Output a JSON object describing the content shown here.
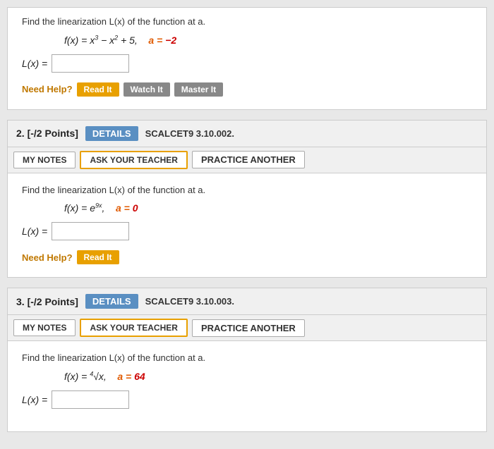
{
  "cards": [
    {
      "id": "card1",
      "number": "2. [-/2 Points]",
      "details_label": "DETAILS",
      "code": "SCALCET9 3.10.002.",
      "my_notes_label": "MY NOTES",
      "ask_teacher_label": "ASK YOUR TEACHER",
      "practice_label": "PRACTICE ANOTHER",
      "instruction": "Find the linearization L(x) of the function at a.",
      "formula_parts": {
        "fx": "f(x) = e",
        "exp": "9x",
        "comma": ",",
        "a_label": "a",
        "a_eq": "=",
        "a_val": "0"
      },
      "lx_label": "L(x) =",
      "need_help_label": "Need Help?",
      "help_buttons": [
        "Read It"
      ]
    },
    {
      "id": "card2",
      "number": "3. [-/2 Points]",
      "details_label": "DETAILS",
      "code": "SCALCET9 3.10.003.",
      "my_notes_label": "MY NOTES",
      "ask_teacher_label": "ASK YOUR TEACHER",
      "practice_label": "PRACTICE ANOTHER",
      "instruction": "Find the linearization L(x) of the function at a.",
      "formula_parts": {
        "fx": "f(x) = ",
        "root": "4",
        "under": "x",
        "comma": ",",
        "a_label": "a",
        "a_eq": "=",
        "a_val": "64"
      },
      "lx_label": "L(x) =",
      "need_help_label": null,
      "help_buttons": []
    }
  ],
  "top_snippet": {
    "instruction": "Find the linearization L(x) of the function at a.",
    "formula": "f(x) = x³ − x² + 5,",
    "a_label": "a",
    "a_eq": "=",
    "a_val": "−2",
    "lx_label": "L(x) =",
    "need_help_label": "Need Help?",
    "help_buttons": [
      "Read It",
      "Watch It",
      "Master It"
    ]
  }
}
